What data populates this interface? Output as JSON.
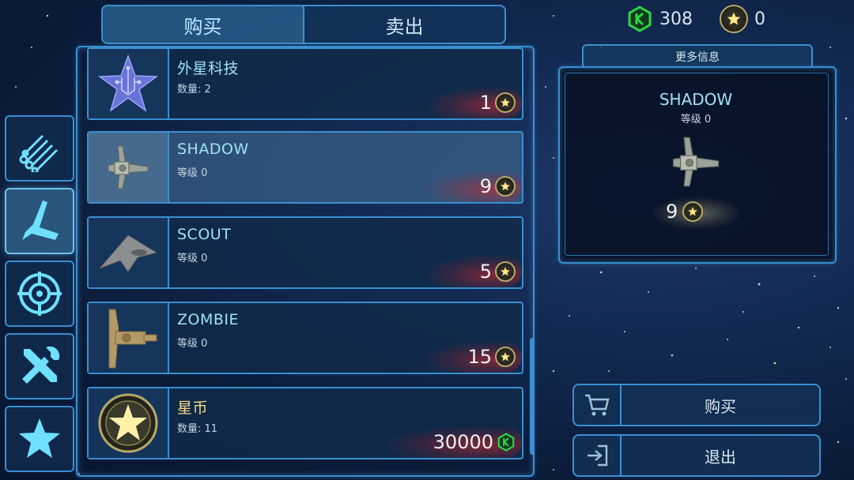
{
  "tabs": [
    {
      "label": "购买",
      "active": true
    },
    {
      "label": "卖出",
      "active": false
    }
  ],
  "currency": {
    "gems": "308",
    "stars": "0"
  },
  "categories": [
    {
      "icon": "materials-icon",
      "active": false
    },
    {
      "icon": "ship-icon",
      "active": true
    },
    {
      "icon": "target-icon",
      "active": false
    },
    {
      "icon": "tools-icon",
      "active": false
    },
    {
      "icon": "star-icon",
      "active": false
    }
  ],
  "items": [
    {
      "name": "外星科技",
      "sub": "数量: 2",
      "price": "1",
      "currency": "star",
      "icon": "alien-tech-icon"
    },
    {
      "name": "SHADOW",
      "sub": "等级 0",
      "price": "9",
      "currency": "star",
      "icon": "shadow-ship-icon",
      "selected": true
    },
    {
      "name": "SCOUT",
      "sub": "等级 0",
      "price": "5",
      "currency": "star",
      "icon": "scout-ship-icon"
    },
    {
      "name": "ZOMBIE",
      "sub": "等级 0",
      "price": "15",
      "currency": "star",
      "icon": "zombie-ship-icon"
    },
    {
      "name": "星币",
      "sub": "数量: 11",
      "price": "30000",
      "currency": "gem",
      "icon": "star-coin-icon"
    }
  ],
  "info": {
    "tab_label": "更多信息",
    "name": "SHADOW",
    "level": "等级 0",
    "price": "9"
  },
  "actions": {
    "buy_label": "购买",
    "exit_label": "退出"
  },
  "colors": {
    "frame": "#3b8fd0",
    "name": "#9fe1f5",
    "gold": "#f2dc8a",
    "gem": "#2fd44a"
  }
}
